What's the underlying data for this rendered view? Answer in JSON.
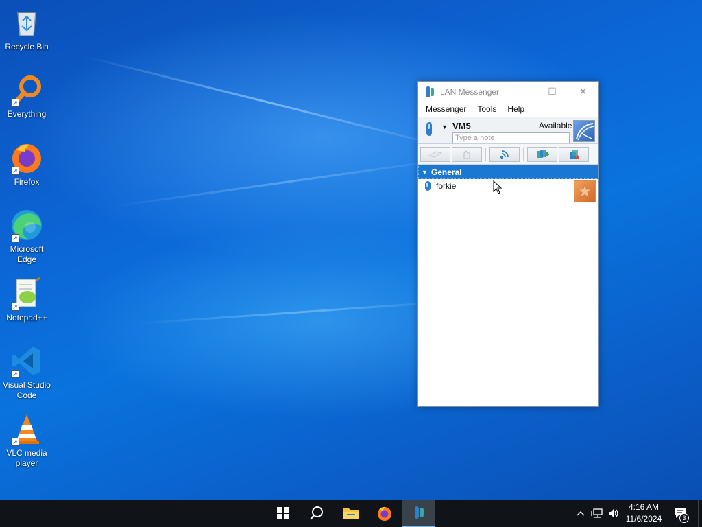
{
  "desktop": {
    "icons": [
      {
        "label": "Recycle Bin",
        "icon": "recycle-bin-icon"
      },
      {
        "label": "Everything",
        "icon": "everything-search-icon"
      },
      {
        "label": "Firefox",
        "icon": "firefox-icon"
      },
      {
        "label": "Microsoft Edge",
        "icon": "edge-icon"
      },
      {
        "label": "Notepad++",
        "icon": "notepad-plus-plus-icon"
      },
      {
        "label": "Visual Studio Code",
        "icon": "vscode-icon"
      },
      {
        "label": "VLC media player",
        "icon": "vlc-icon"
      }
    ]
  },
  "window": {
    "title": "LAN Messenger",
    "controls": {
      "minimize": "—",
      "maximize": "☐",
      "close": "✕"
    },
    "menu": [
      "Messenger",
      "Tools",
      "Help"
    ],
    "self": {
      "name": "VM5",
      "status": "Available",
      "note_placeholder": "Type a note",
      "status_color": "#2f7fd0"
    },
    "toolbar": [
      {
        "name": "chat-button",
        "icon": "chat-icon",
        "enabled": false
      },
      {
        "name": "file-button",
        "icon": "file-icon",
        "enabled": false
      },
      {
        "name": "broadcast-button",
        "icon": "broadcast-icon",
        "enabled": true
      },
      {
        "name": "add-contact-button",
        "icon": "add-contact-icon",
        "enabled": true
      },
      {
        "name": "refresh-button",
        "icon": "refresh-icon",
        "enabled": true
      }
    ],
    "groups": [
      {
        "name": "General",
        "expanded": true,
        "contacts": [
          {
            "name": "forkie",
            "avatar": "starfish-avatar"
          }
        ]
      }
    ]
  },
  "taskbar": {
    "apps": [
      "start-button",
      "search-button",
      "file-explorer",
      "firefox",
      "lan-messenger"
    ],
    "active_app": "lan-messenger",
    "clock": {
      "time": "4:16 AM",
      "date": "11/6/2024"
    },
    "notifications": "3"
  },
  "colors": {
    "accent": "#1a78d2",
    "taskbar": "#101418",
    "desktop": "#0a66d6"
  }
}
